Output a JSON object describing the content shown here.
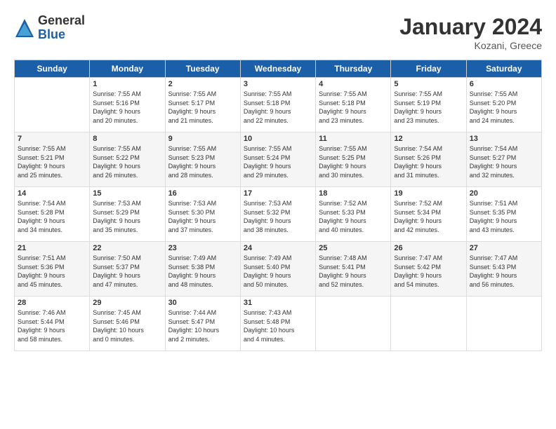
{
  "logo": {
    "general": "General",
    "blue": "Blue"
  },
  "header": {
    "month": "January 2024",
    "location": "Kozani, Greece"
  },
  "columns": [
    "Sunday",
    "Monday",
    "Tuesday",
    "Wednesday",
    "Thursday",
    "Friday",
    "Saturday"
  ],
  "weeks": [
    [
      {
        "day": "",
        "info": ""
      },
      {
        "day": "1",
        "info": "Sunrise: 7:55 AM\nSunset: 5:16 PM\nDaylight: 9 hours\nand 20 minutes."
      },
      {
        "day": "2",
        "info": "Sunrise: 7:55 AM\nSunset: 5:17 PM\nDaylight: 9 hours\nand 21 minutes."
      },
      {
        "day": "3",
        "info": "Sunrise: 7:55 AM\nSunset: 5:18 PM\nDaylight: 9 hours\nand 22 minutes."
      },
      {
        "day": "4",
        "info": "Sunrise: 7:55 AM\nSunset: 5:18 PM\nDaylight: 9 hours\nand 23 minutes."
      },
      {
        "day": "5",
        "info": "Sunrise: 7:55 AM\nSunset: 5:19 PM\nDaylight: 9 hours\nand 23 minutes."
      },
      {
        "day": "6",
        "info": "Sunrise: 7:55 AM\nSunset: 5:20 PM\nDaylight: 9 hours\nand 24 minutes."
      }
    ],
    [
      {
        "day": "7",
        "info": "Sunrise: 7:55 AM\nSunset: 5:21 PM\nDaylight: 9 hours\nand 25 minutes."
      },
      {
        "day": "8",
        "info": "Sunrise: 7:55 AM\nSunset: 5:22 PM\nDaylight: 9 hours\nand 26 minutes."
      },
      {
        "day": "9",
        "info": "Sunrise: 7:55 AM\nSunset: 5:23 PM\nDaylight: 9 hours\nand 28 minutes."
      },
      {
        "day": "10",
        "info": "Sunrise: 7:55 AM\nSunset: 5:24 PM\nDaylight: 9 hours\nand 29 minutes."
      },
      {
        "day": "11",
        "info": "Sunrise: 7:55 AM\nSunset: 5:25 PM\nDaylight: 9 hours\nand 30 minutes."
      },
      {
        "day": "12",
        "info": "Sunrise: 7:54 AM\nSunset: 5:26 PM\nDaylight: 9 hours\nand 31 minutes."
      },
      {
        "day": "13",
        "info": "Sunrise: 7:54 AM\nSunset: 5:27 PM\nDaylight: 9 hours\nand 32 minutes."
      }
    ],
    [
      {
        "day": "14",
        "info": "Sunrise: 7:54 AM\nSunset: 5:28 PM\nDaylight: 9 hours\nand 34 minutes."
      },
      {
        "day": "15",
        "info": "Sunrise: 7:53 AM\nSunset: 5:29 PM\nDaylight: 9 hours\nand 35 minutes."
      },
      {
        "day": "16",
        "info": "Sunrise: 7:53 AM\nSunset: 5:30 PM\nDaylight: 9 hours\nand 37 minutes."
      },
      {
        "day": "17",
        "info": "Sunrise: 7:53 AM\nSunset: 5:32 PM\nDaylight: 9 hours\nand 38 minutes."
      },
      {
        "day": "18",
        "info": "Sunrise: 7:52 AM\nSunset: 5:33 PM\nDaylight: 9 hours\nand 40 minutes."
      },
      {
        "day": "19",
        "info": "Sunrise: 7:52 AM\nSunset: 5:34 PM\nDaylight: 9 hours\nand 42 minutes."
      },
      {
        "day": "20",
        "info": "Sunrise: 7:51 AM\nSunset: 5:35 PM\nDaylight: 9 hours\nand 43 minutes."
      }
    ],
    [
      {
        "day": "21",
        "info": "Sunrise: 7:51 AM\nSunset: 5:36 PM\nDaylight: 9 hours\nand 45 minutes."
      },
      {
        "day": "22",
        "info": "Sunrise: 7:50 AM\nSunset: 5:37 PM\nDaylight: 9 hours\nand 47 minutes."
      },
      {
        "day": "23",
        "info": "Sunrise: 7:49 AM\nSunset: 5:38 PM\nDaylight: 9 hours\nand 48 minutes."
      },
      {
        "day": "24",
        "info": "Sunrise: 7:49 AM\nSunset: 5:40 PM\nDaylight: 9 hours\nand 50 minutes."
      },
      {
        "day": "25",
        "info": "Sunrise: 7:48 AM\nSunset: 5:41 PM\nDaylight: 9 hours\nand 52 minutes."
      },
      {
        "day": "26",
        "info": "Sunrise: 7:47 AM\nSunset: 5:42 PM\nDaylight: 9 hours\nand 54 minutes."
      },
      {
        "day": "27",
        "info": "Sunrise: 7:47 AM\nSunset: 5:43 PM\nDaylight: 9 hours\nand 56 minutes."
      }
    ],
    [
      {
        "day": "28",
        "info": "Sunrise: 7:46 AM\nSunset: 5:44 PM\nDaylight: 9 hours\nand 58 minutes."
      },
      {
        "day": "29",
        "info": "Sunrise: 7:45 AM\nSunset: 5:46 PM\nDaylight: 10 hours\nand 0 minutes."
      },
      {
        "day": "30",
        "info": "Sunrise: 7:44 AM\nSunset: 5:47 PM\nDaylight: 10 hours\nand 2 minutes."
      },
      {
        "day": "31",
        "info": "Sunrise: 7:43 AM\nSunset: 5:48 PM\nDaylight: 10 hours\nand 4 minutes."
      },
      {
        "day": "",
        "info": ""
      },
      {
        "day": "",
        "info": ""
      },
      {
        "day": "",
        "info": ""
      }
    ]
  ]
}
